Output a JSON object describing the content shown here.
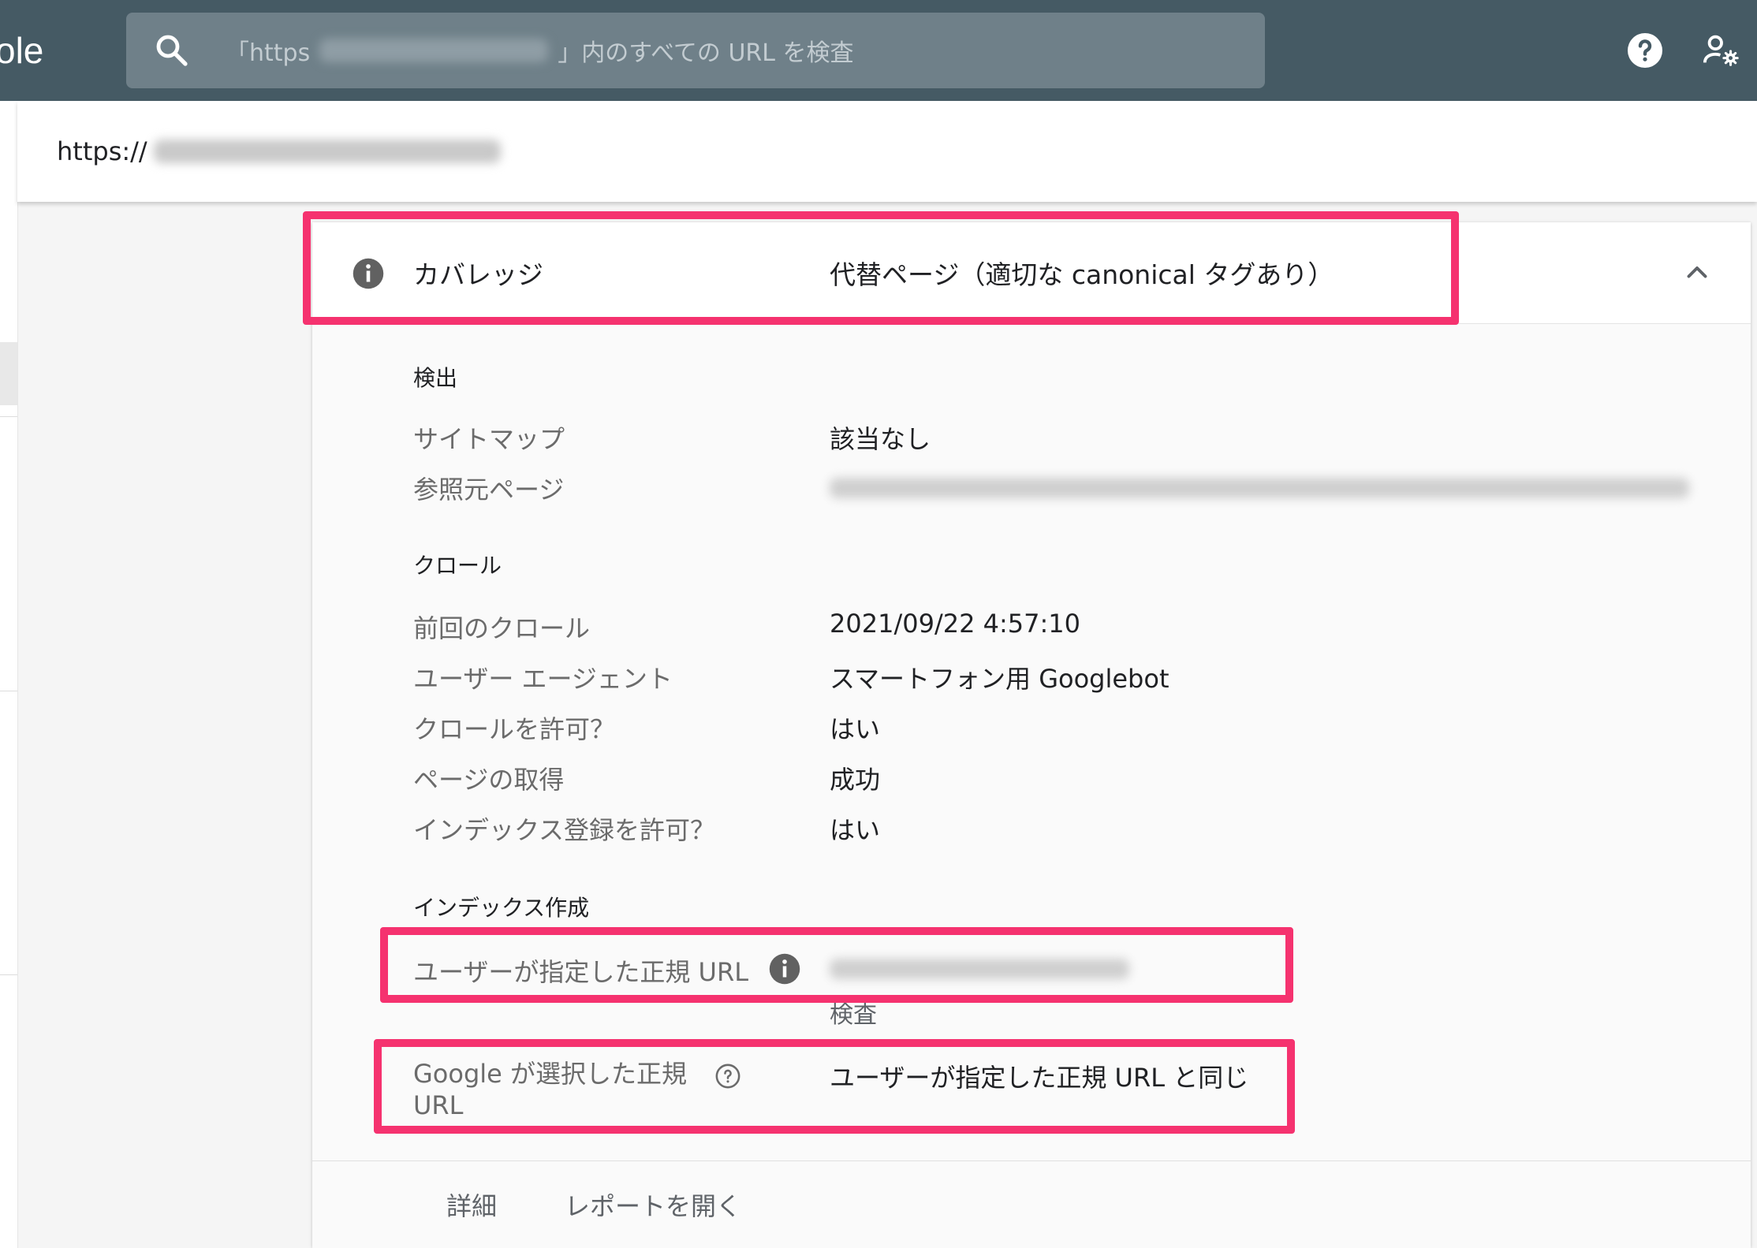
{
  "app": {
    "logo_fragment": "ole"
  },
  "search": {
    "prefix": "「https",
    "suffix": "」内のすべての URL を検査"
  },
  "header": {
    "help_icon": "help-circle-icon",
    "admin_icon": "manage-accounts-icon"
  },
  "url_bar": {
    "prefix": "https://"
  },
  "coverage": {
    "label": "カバレッジ",
    "value": "代替ページ（適切な canonical タグあり）",
    "info_icon": "info-icon",
    "toggle_icon": "chevron-up-icon"
  },
  "discovery": {
    "title": "検出",
    "rows": [
      {
        "label": "サイトマップ",
        "value": "該当なし"
      },
      {
        "label": "参照元ページ"
      }
    ]
  },
  "crawl": {
    "title": "クロール",
    "rows": [
      {
        "label": "前回のクロール",
        "value": "2021/09/22 4:57:10"
      },
      {
        "label": "ユーザー エージェント",
        "value": "スマートフォン用 Googlebot"
      },
      {
        "label": "クロールを許可？",
        "value": "はい"
      },
      {
        "label": "ページの取得",
        "value": "成功"
      },
      {
        "label": "インデックス登録を許可？",
        "value": "はい"
      }
    ]
  },
  "indexing": {
    "title": "インデックス作成",
    "user_canonical": {
      "label": "ユーザーが指定した正規 URL",
      "inspect_link": "検査"
    },
    "google_canonical": {
      "label_line1": "Google が選択した正規",
      "label_line2": "URL",
      "value": "ユーザーが指定した正規 URL と同じ"
    }
  },
  "footer": {
    "details": "詳細",
    "open_report": "レポートを開く"
  },
  "colors": {
    "topbar": "#455a64",
    "highlight": "#f5326f"
  }
}
